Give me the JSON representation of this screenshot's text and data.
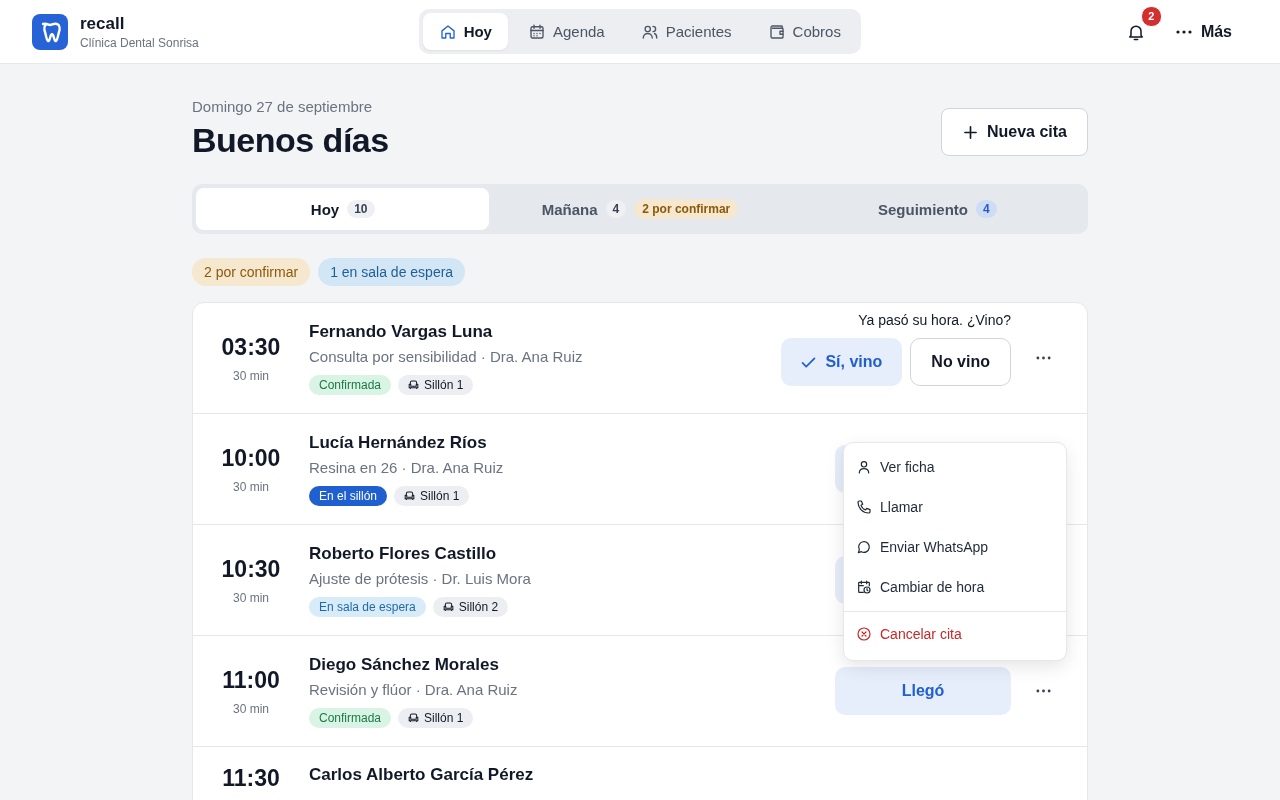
{
  "brand": {
    "name": "recall",
    "subtitle": "Clínica Dental Sonrisa"
  },
  "nav": [
    {
      "label": "Hoy",
      "selected": true
    },
    {
      "label": "Agenda",
      "selected": false
    },
    {
      "label": "Pacientes",
      "selected": false
    },
    {
      "label": "Cobros",
      "selected": false
    }
  ],
  "notifications": {
    "count": "2"
  },
  "more": {
    "label": "Más"
  },
  "date": "Domingo 27 de septiembre",
  "greeting": "Buenos días",
  "new_button": {
    "label": "Nueva cita"
  },
  "tabs": [
    {
      "label": "Hoy",
      "count": "10",
      "kind": "neutral",
      "selected": true
    },
    {
      "label": "Mañana",
      "count": "4",
      "kind": "neutral",
      "pill": "2 por confirmar",
      "selected": false
    },
    {
      "label": "Seguimiento",
      "count": "4",
      "kind": "info",
      "selected": false
    }
  ],
  "summary": [
    {
      "text": "2 por confirmar",
      "kind": "warning"
    },
    {
      "text": "1 en sala de espera",
      "kind": "info"
    }
  ],
  "appointments": [
    {
      "time": "03:30",
      "duration": "30 min",
      "name": "Fernando Vargas Luna",
      "detail": "Consulta por sensibilidad · Dra. Ana Ruiz",
      "status": {
        "text": "Confirmada",
        "kind": "success"
      },
      "chair": "Sillón 1",
      "action": {
        "kind": "attendance",
        "prompt": "Ya pasó su hora. ¿Vino?",
        "yes": "Sí, vino",
        "no": "No vino"
      }
    },
    {
      "time": "10:00",
      "duration": "30 min",
      "name": "Lucía Hernández Ríos",
      "detail": "Resina en 26 · Dra. Ana Ruiz",
      "status": {
        "text": "En el sillón",
        "kind": "primary"
      },
      "chair": "Sillón 1",
      "action": {
        "kind": "covered"
      },
      "menu_open": true
    },
    {
      "time": "10:30",
      "duration": "30 min",
      "name": "Roberto Flores Castillo",
      "detail": "Ajuste de prótesis · Dr. Luis Mora",
      "status": {
        "text": "En sala de espera",
        "kind": "info"
      },
      "chair": "Sillón 2",
      "action": {
        "kind": "covered"
      }
    },
    {
      "time": "11:00",
      "duration": "30 min",
      "name": "Diego Sánchez Morales",
      "detail": "Revisión y flúor · Dra. Ana Ruiz",
      "status": {
        "text": "Confirmada",
        "kind": "success"
      },
      "chair": "Sillón 1",
      "action": {
        "kind": "arrived",
        "label": "Llegó"
      }
    },
    {
      "time": "11:30",
      "name": "Carlos Alberto García Pérez"
    }
  ],
  "menu": {
    "items": [
      {
        "label": "Ver ficha",
        "kind": "normal"
      },
      {
        "label": "Llamar",
        "kind": "normal"
      },
      {
        "label": "Enviar WhatsApp",
        "kind": "normal"
      },
      {
        "label": "Cambiar de hora",
        "kind": "normal"
      },
      {
        "label": "Cancelar cita",
        "kind": "danger"
      }
    ]
  }
}
